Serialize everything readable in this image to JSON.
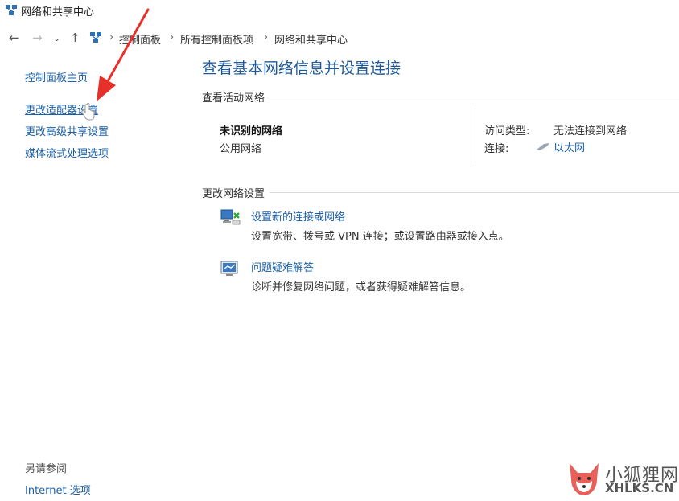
{
  "window": {
    "title": "网络和共享中心"
  },
  "address": {
    "back": "←",
    "forward": "→",
    "recent": "⌄",
    "up": "↑",
    "crumbs": [
      "控制面板",
      "所有控制面板项",
      "网络和共享中心"
    ],
    "separator": "›"
  },
  "sidebar": {
    "home": "控制面板主页",
    "links": [
      "更改适配器设置",
      "更改高级共享设置",
      "媒体流式处理选项"
    ],
    "see_also": "另请参阅",
    "see_also_links": [
      "Internet 选项"
    ]
  },
  "main": {
    "title": "查看基本网络信息并设置连接",
    "active_section": "查看活动网络",
    "network": {
      "name": "未识别的网络",
      "type": "公用网络",
      "access_label": "访问类型:",
      "access_value": "无法连接到网络",
      "connection_label": "连接:",
      "connection_value": "以太网"
    },
    "change_section": "更改网络设置",
    "tasks": [
      {
        "title": "设置新的连接或网络",
        "desc": "设置宽带、拨号或 VPN 连接；或设置路由器或接入点。",
        "icon": "network-setup-icon"
      },
      {
        "title": "问题疑难解答",
        "desc": "诊断并修复网络问题，或者获得疑难解答信息。",
        "icon": "troubleshoot-icon"
      }
    ]
  },
  "watermark": {
    "brand_cn": "小狐狸网",
    "brand_en": "XHLKS.CN"
  },
  "colors": {
    "link": "#1a5fa8",
    "title": "#1e5a9b",
    "arrow": "#e8302a"
  }
}
